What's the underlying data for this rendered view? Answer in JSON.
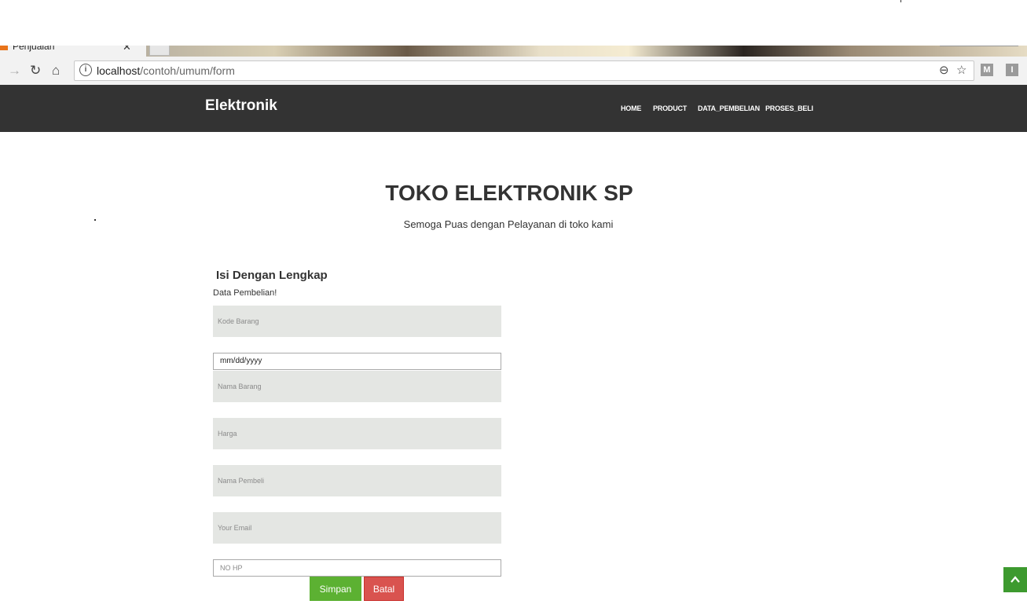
{
  "browser": {
    "tab_title": "Penjualan",
    "tab_close": "✕",
    "url_host": "localhost",
    "url_path": "/contoh/umum/form",
    "ext1": "M",
    "ext2": "I"
  },
  "site": {
    "brand": "Elektronik",
    "menu": [
      "HOME",
      "PRODUCT",
      "DATA_PEMBELIAN",
      "PROSES_BELI"
    ]
  },
  "hero": {
    "title": "TOKO ELEKTRONIK SP",
    "subtitle": "Semoga Puas dengan Pelayanan di toko kami"
  },
  "form": {
    "heading": "Isi Dengan Lengkap",
    "subheading": "Data Pembelian!",
    "kode_barang_placeholder": "Kode Barang",
    "date_value": "mm/dd/yyyy",
    "nama_barang_placeholder": "Nama Barang",
    "harga_placeholder": "Harga",
    "nama_pembeli_placeholder": "Nama Pembeli",
    "email_placeholder": "Your Email",
    "hp_placeholder": "NO HP",
    "save_label": "Simpan",
    "cancel_label": "Batal"
  },
  "colors": {
    "navbar": "#333333",
    "save_button": "#5cb132",
    "cancel_button": "#d9534f",
    "scroll_top": "#3d9a2f"
  },
  "icons": {
    "scroll_top": "chevron-up-icon"
  }
}
